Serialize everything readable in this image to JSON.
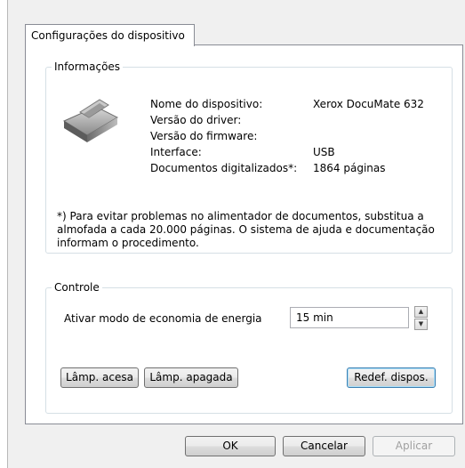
{
  "tab": {
    "label": "Configurações do dispositivo"
  },
  "info": {
    "legend": "Informações",
    "device_icon": "scanner-icon",
    "rows": [
      {
        "label": "Nome do dispositivo:",
        "value": "Xerox DocuMate 632"
      },
      {
        "label": "Versão do driver:",
        "value": ""
      },
      {
        "label": "Versão do firmware:",
        "value": ""
      },
      {
        "label": "Interface:",
        "value": "USB"
      },
      {
        "label": "Documentos digitalizados*:",
        "value": "1864 páginas"
      }
    ],
    "note": "*) Para evitar problemas no alimentador de documentos, substitua a almofada a cada 20.000 páginas. O sistema de ajuda e documentação informam o procedimento."
  },
  "control": {
    "legend": "Controle",
    "power_save_label": "Ativar modo de economia de energia",
    "power_save_value": "15 min",
    "lamp_on": "Lâmp. acesa",
    "lamp_off": "Lâmp. apagada",
    "reset": "Redef. dispos."
  },
  "footer": {
    "ok": "OK",
    "cancel": "Cancelar",
    "apply": "Aplicar"
  }
}
